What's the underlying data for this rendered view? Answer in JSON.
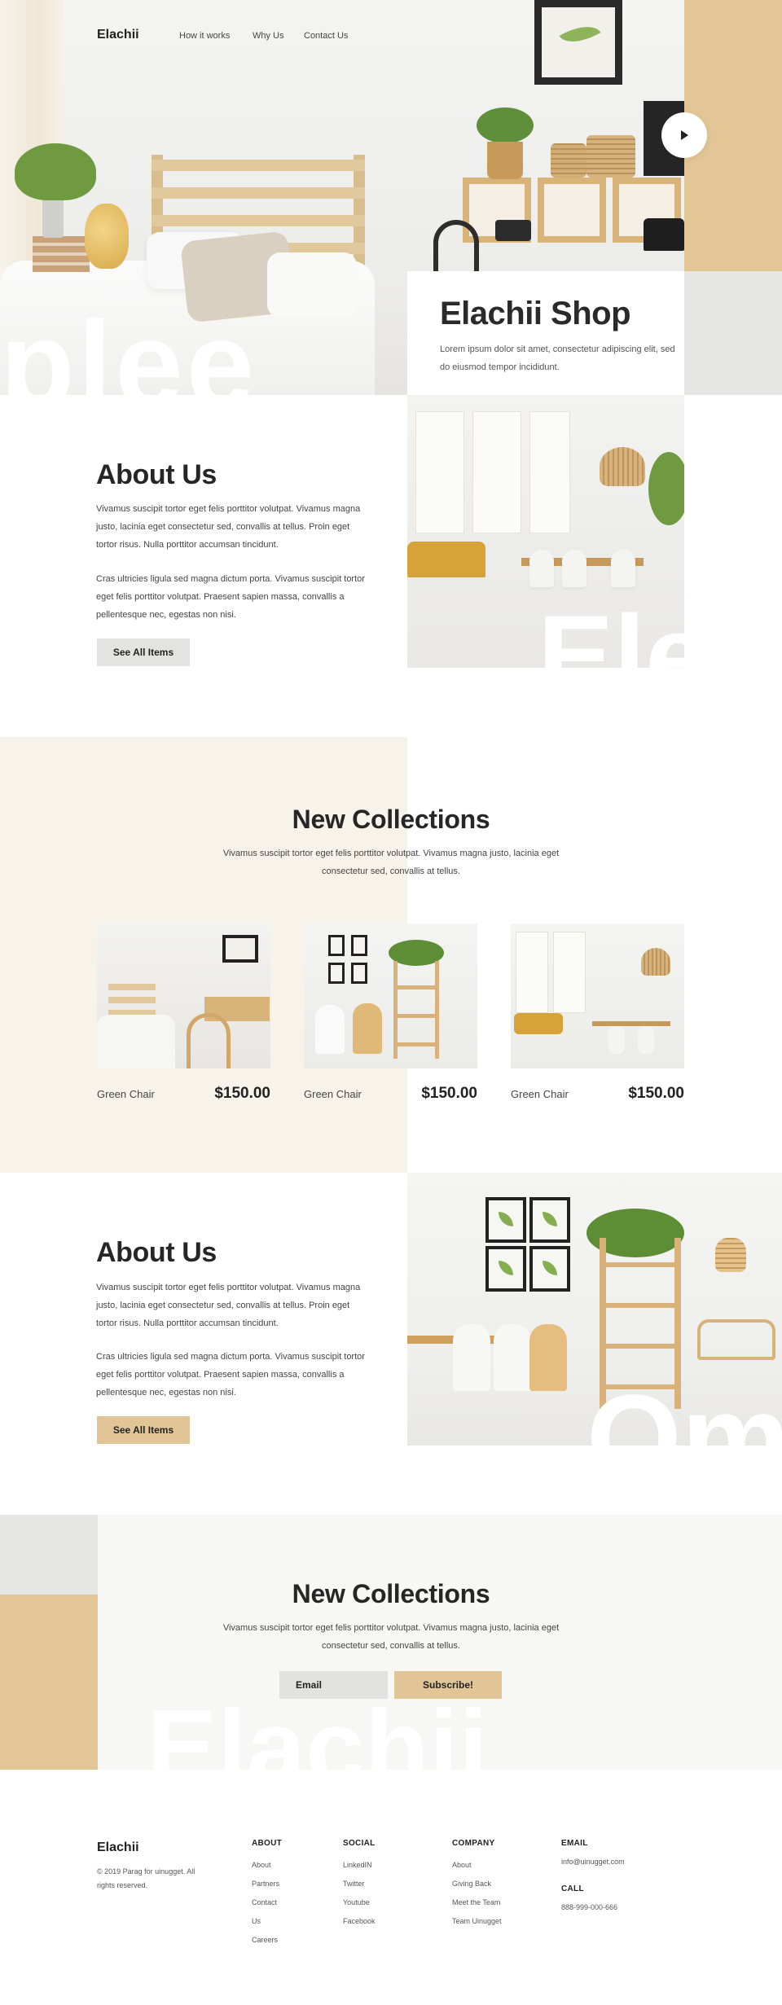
{
  "nav": {
    "logo": "Elachii",
    "links": [
      "How it works",
      "Why Us",
      "Contact Us"
    ]
  },
  "hero": {
    "title": "Elachii Shop",
    "description": "Lorem ipsum dolor sit amet, consectetur adipiscing elit, sed do eiusmod tempor incididunt.",
    "ghost_text": "plee",
    "play_icon": "play-icon"
  },
  "about1": {
    "title": "About Us",
    "paragraph1": "Vivamus suscipit tortor eget felis porttitor volutpat. Vivamus magna justo, lacinia eget consectetur sed, convallis at tellus. Proin eget tortor risus. Nulla porttitor accumsan tincidunt.",
    "paragraph2": "Cras ultricies ligula sed magna dictum porta. Vivamus suscipit tortor eget felis porttitor volutpat. Praesent sapien massa, convallis a pellentesque nec, egestas non nisi.",
    "button": "See All Items",
    "ghost_text": "Ele"
  },
  "collections": {
    "title": "New Collections",
    "subtitle_line1": "Vivamus suscipit tortor eget felis porttitor volutpat. Vivamus magna justo, lacinia eget",
    "subtitle_line2": "consectetur sed, convallis at tellus.",
    "products": [
      {
        "name": "Green Chair",
        "price": "$150.00"
      },
      {
        "name": "Green Chair",
        "price": "$150.00"
      },
      {
        "name": "Green Chair",
        "price": "$150.00"
      }
    ]
  },
  "about2": {
    "title": "About Us",
    "paragraph1": "Vivamus suscipit tortor eget felis porttitor volutpat. Vivamus magna justo, lacinia eget consectetur sed, convallis at tellus. Proin eget tortor risus. Nulla porttitor accumsan tincidunt.",
    "paragraph2": "Cras ultricies ligula sed magna dictum porta. Vivamus suscipit tortor eget felis porttitor volutpat. Praesent sapien massa, convallis a pellentesque nec, egestas non nisi.",
    "button": "See All Items",
    "ghost_text": "Om"
  },
  "newsletter": {
    "title": "New Collections",
    "subtitle_line1": "Vivamus suscipit tortor eget felis porttitor volutpat. Vivamus magna justo, lacinia eget",
    "subtitle_line2": "consectetur sed, convallis at tellus.",
    "email_placeholder": "Email",
    "subscribe": "Subscribe!",
    "ghost_text": "Elachii"
  },
  "footer": {
    "logo": "Elachii",
    "copyright": "© 2019 Parag for uinugget. All rights reserved.",
    "about": {
      "heading": "ABOUT",
      "links": [
        "About",
        "Partners",
        "Contact",
        "Us",
        "Careers"
      ]
    },
    "social": {
      "heading": "SOCIAL",
      "links": [
        "LinkedIN",
        "Twitter",
        "Youtube",
        "Facebook"
      ]
    },
    "company": {
      "heading": "COMPANY",
      "links": [
        "About",
        "Giving Back",
        "Meet the Team",
        "Team Uinugget"
      ]
    },
    "email": {
      "heading": "EMAIL",
      "value": "info@uinugget.com"
    },
    "call": {
      "heading": "CALL",
      "value": "888-999-000-666"
    }
  },
  "colors": {
    "accent_tan": "#e1c596",
    "cream_bg": "#f8f3ea",
    "light_gray": "#e6e6e4",
    "text_dark": "#222222"
  }
}
